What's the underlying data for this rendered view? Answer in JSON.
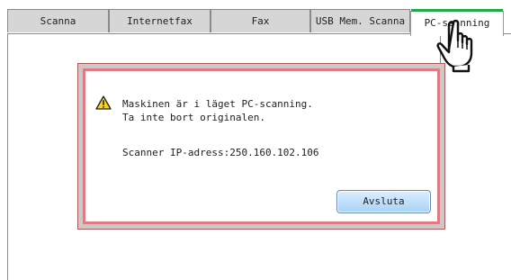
{
  "tabs": [
    {
      "label": "Scanna"
    },
    {
      "label": "Internetfax"
    },
    {
      "label": "Fax"
    },
    {
      "label": "USB Mem. Scanna"
    },
    {
      "label": "PC-scanning"
    }
  ],
  "active_tab": "PC-scanning",
  "dialog": {
    "icon": "warning-icon",
    "message_line1": "Maskinen är i läget PC-scanning.",
    "message_line2": "Ta inte bort originalen.",
    "scanner_ip": "Scanner IP-adress:250.160.102.106",
    "close_button_label": "Avsluta"
  },
  "cursor": "hand-pointer-icon",
  "colors": {
    "active_tab_strip": "#23a84a",
    "dialog_border": "#e07b86",
    "button_fill": "#a7d2f6"
  }
}
